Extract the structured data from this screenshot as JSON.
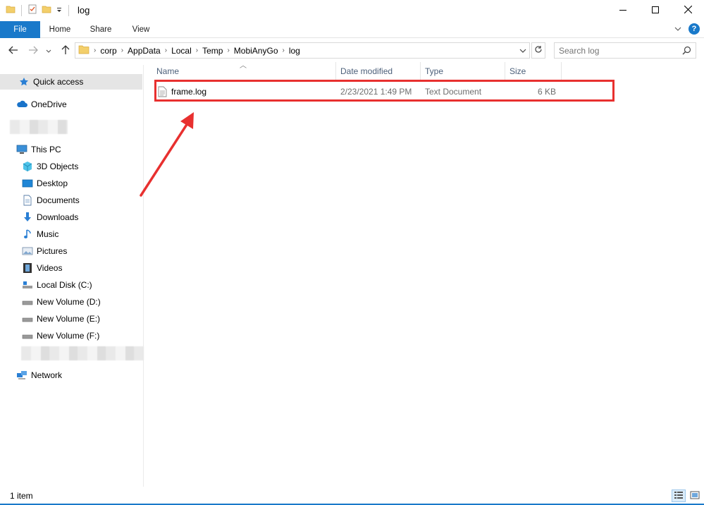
{
  "window": {
    "title": "log",
    "controls": {
      "minimize": "minimize-icon",
      "maximize": "maximize-icon",
      "close": "close-icon"
    }
  },
  "ribbon": {
    "tabs": [
      "File",
      "Home",
      "Share",
      "View"
    ]
  },
  "address": {
    "crumbs": [
      "corp",
      "AppData",
      "Local",
      "Temp",
      "MobiAnyGo",
      "log"
    ]
  },
  "search": {
    "placeholder": "Search log"
  },
  "navpane": {
    "quick_access": "Quick access",
    "onedrive": "OneDrive",
    "this_pc": "This PC",
    "pc_items": [
      "3D Objects",
      "Desktop",
      "Documents",
      "Downloads",
      "Music",
      "Pictures",
      "Videos",
      "Local Disk (C:)",
      "New Volume (D:)",
      "New Volume (E:)",
      "New Volume (F:)"
    ],
    "network": "Network"
  },
  "columns": {
    "name": "Name",
    "date": "Date modified",
    "type": "Type",
    "size": "Size"
  },
  "files": [
    {
      "name": "frame.log",
      "date": "2/23/2021 1:49 PM",
      "type": "Text Document",
      "size": "6 KB"
    }
  ],
  "status": {
    "count": "1 item"
  },
  "annotation": {
    "color": "#e8302f"
  },
  "colors": {
    "accent": "#1979ca"
  }
}
